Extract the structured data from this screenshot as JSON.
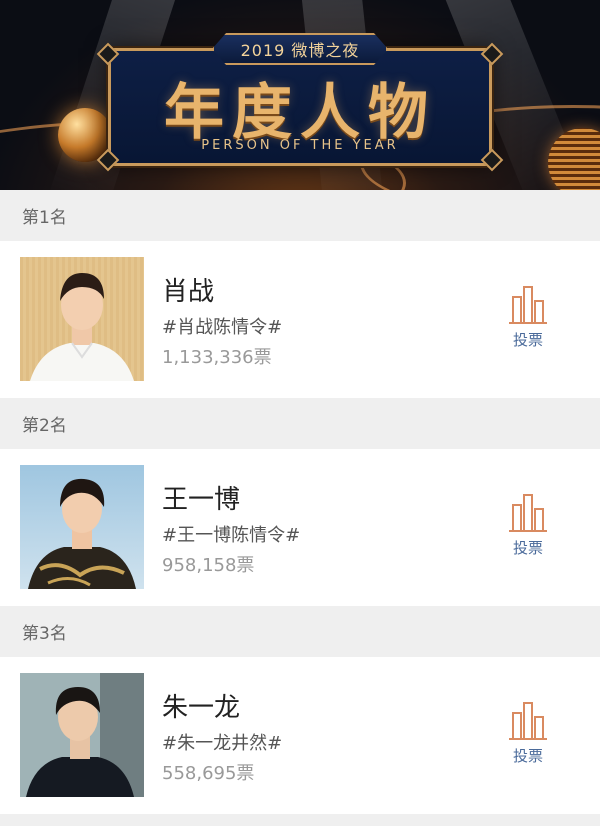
{
  "banner": {
    "tab_text": "2019 微博之夜",
    "title": "年度人物",
    "subtitle": "PERSON OF THE YEAR"
  },
  "ranks": [
    {
      "rank_label": "第1名",
      "name": "肖战",
      "tag": "#肖战陈情令#",
      "votes": "1,133,336票",
      "vote_label": "投票"
    },
    {
      "rank_label": "第2名",
      "name": "王一博",
      "tag": "#王一博陈情令#",
      "votes": "958,158票",
      "vote_label": "投票"
    },
    {
      "rank_label": "第3名",
      "name": "朱一龙",
      "tag": "#朱一龙井然#",
      "votes": "558,695票",
      "vote_label": "投票"
    }
  ],
  "colors": {
    "vote_icon": "#d98a60",
    "vote_label": "#4a6a9a",
    "gold": "#e8b46c"
  },
  "icons": {
    "vote": "bar-chart-icon"
  }
}
